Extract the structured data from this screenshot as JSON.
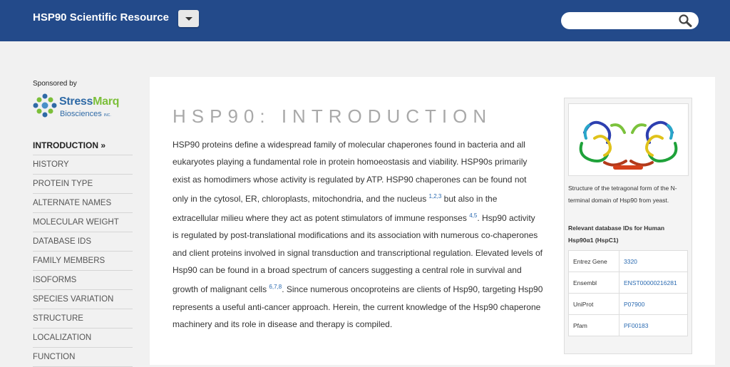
{
  "header": {
    "brand": "HSP90 Scientific Resource",
    "search_placeholder": "",
    "colors": {
      "bar": "#234a8a",
      "link": "#2a6ab1",
      "logo_green": "#7cbf3a"
    }
  },
  "sidebar": {
    "sponsor_label": "Sponsored by",
    "sponsor": {
      "name_part1": "Stress",
      "name_part2": "Marq",
      "sub": "Biosciences",
      "sub_small": "INC."
    },
    "items": [
      {
        "label": "INTRODUCTION »",
        "active": true
      },
      {
        "label": "HISTORY"
      },
      {
        "label": "PROTEIN TYPE"
      },
      {
        "label": "ALTERNATE NAMES"
      },
      {
        "label": "MOLECULAR WEIGHT"
      },
      {
        "label": "DATABASE IDS"
      },
      {
        "label": "FAMILY MEMBERS"
      },
      {
        "label": "ISOFORMS"
      },
      {
        "label": "SPECIES VARIATION"
      },
      {
        "label": "STRUCTURE"
      },
      {
        "label": "LOCALIZATION"
      },
      {
        "label": "FUNCTION"
      }
    ]
  },
  "main": {
    "title": "HSP90: INTRODUCTION",
    "intro": {
      "t1": "HSP90 proteins define a widespread family of molecular chaperones found in bacteria and all eukaryotes playing a fundamental role in protein homoeostasis and viability. HSP90s primarily exist as homodimers whose activity is regulated by ATP. HSP90 chaperones can be found not only in the cytosol, ER, chloroplasts, mitochondria, and the nucleus ",
      "r1": "1,2,3",
      "t2": " but also in the extracellular milieu where they act as potent stimulators of immune responses ",
      "r2": "4,5",
      "t3": ". Hsp90 activity is regulated by post-translational modifications and its association with numerous co-chaperones and client proteins involved in signal transduction and transcriptional regulation. Elevated levels of Hsp90 can be found in a broad spectrum of cancers suggesting a central role in survival and growth of malignant cells ",
      "r3": "6,7,8",
      "t4": ". Since numerous oncoproteins are clients of Hsp90, targeting Hsp90 represents a useful anti-cancer approach. Herein, the current knowledge of the Hsp90 chaperone machinery and its role in disease and therapy is compiled."
    }
  },
  "infobox": {
    "caption": "Structure of the tetragonal form of the N-terminal domain of Hsp90 from yeast.",
    "db_title": "Relevant database IDs for Human Hsp90α1 (HspC1)",
    "rows": [
      {
        "key": "Entrez Gene",
        "value": "3320"
      },
      {
        "key": "Ensembl",
        "value": "ENST00000216281"
      },
      {
        "key": "UniProt",
        "value": "P07900"
      },
      {
        "key": "Pfam",
        "value": "PF00183"
      }
    ]
  }
}
